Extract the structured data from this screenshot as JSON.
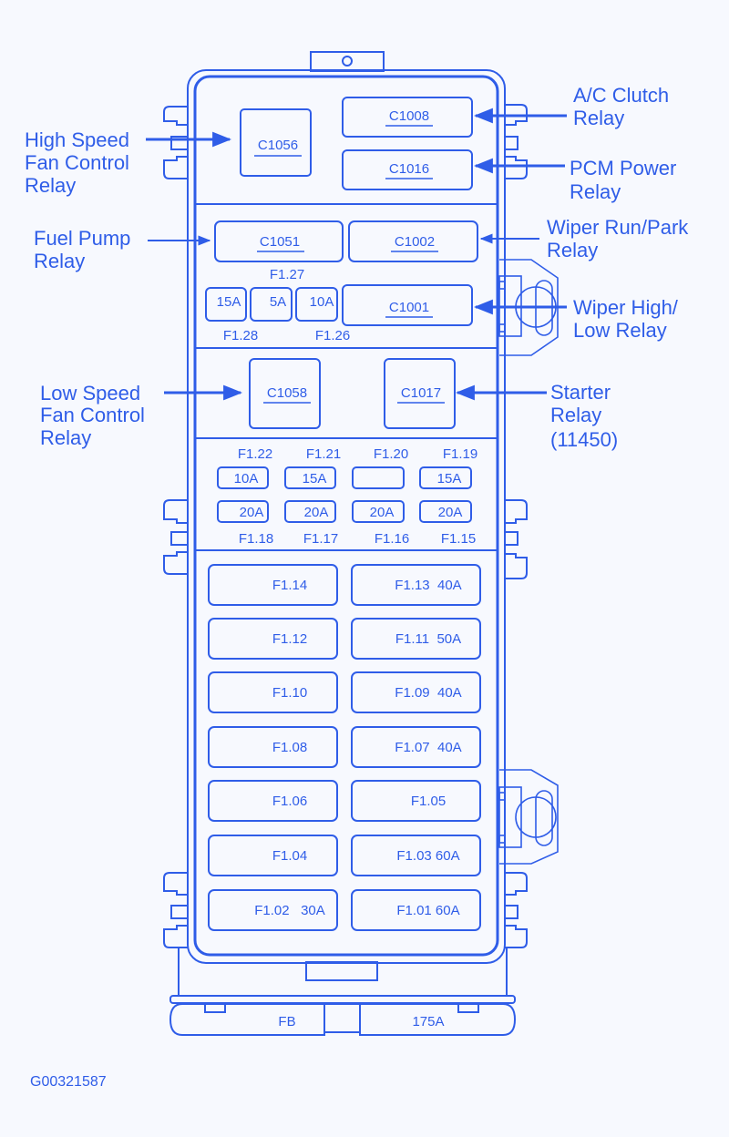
{
  "diagram": {
    "id_code": "G00321587",
    "callouts": {
      "high_speed_fan": [
        "High Speed",
        "Fan Control",
        "Relay"
      ],
      "fuel_pump": [
        "Fuel Pump",
        "Relay"
      ],
      "low_speed_fan": [
        "Low Speed",
        "Fan Control",
        "Relay"
      ],
      "ac_clutch": [
        "A/C Clutch",
        "Relay"
      ],
      "pcm_power": [
        "PCM Power",
        "Relay"
      ],
      "wiper_run_park": [
        "Wiper Run/Park",
        "Relay"
      ],
      "wiper_high_low": [
        "Wiper High/",
        "Low Relay"
      ],
      "starter": [
        "Starter",
        "Relay",
        "(11450)"
      ]
    },
    "relays": {
      "c1056": "C1056",
      "c1008": "C1008",
      "c1016": "C1016",
      "c1051": "C1051",
      "c1002": "C1002",
      "c1001": "C1001",
      "c1058": "C1058",
      "c1017": "C1017"
    },
    "mini_fuses_top": {
      "f128_rating": "15A",
      "f127_rating": "5A",
      "f126_rating": "10A",
      "f127_label": "F1.27",
      "f128_label": "F1.28",
      "f126_label": "F1.26"
    },
    "fuse_row_upper": {
      "labels": [
        "F1.22",
        "F1.21",
        "F1.20",
        "F1.19"
      ],
      "ratings": [
        "10A",
        "15A",
        "",
        "15A"
      ]
    },
    "fuse_row_lower": {
      "labels": [
        "F1.18",
        "F1.17",
        "F1.16",
        "F1.15"
      ],
      "ratings": [
        "20A",
        "20A",
        "20A",
        "20A"
      ]
    },
    "maxi_fuses": [
      {
        "left": "F1.14",
        "right": "F1.13  40A"
      },
      {
        "left": "F1.12",
        "right": "F1.11  50A"
      },
      {
        "left": "F1.10",
        "right": "F1.09  40A"
      },
      {
        "left": "F1.08",
        "right": "F1.07  40A"
      },
      {
        "left": "F1.06",
        "right": "F1.05"
      },
      {
        "left": "F1.04",
        "right": "F1.03 60A"
      },
      {
        "left": "F1.02   30A",
        "right": "F1.01 60A"
      }
    ],
    "bottom_fuse": {
      "left_label": "FB",
      "right_label": "175A"
    }
  }
}
